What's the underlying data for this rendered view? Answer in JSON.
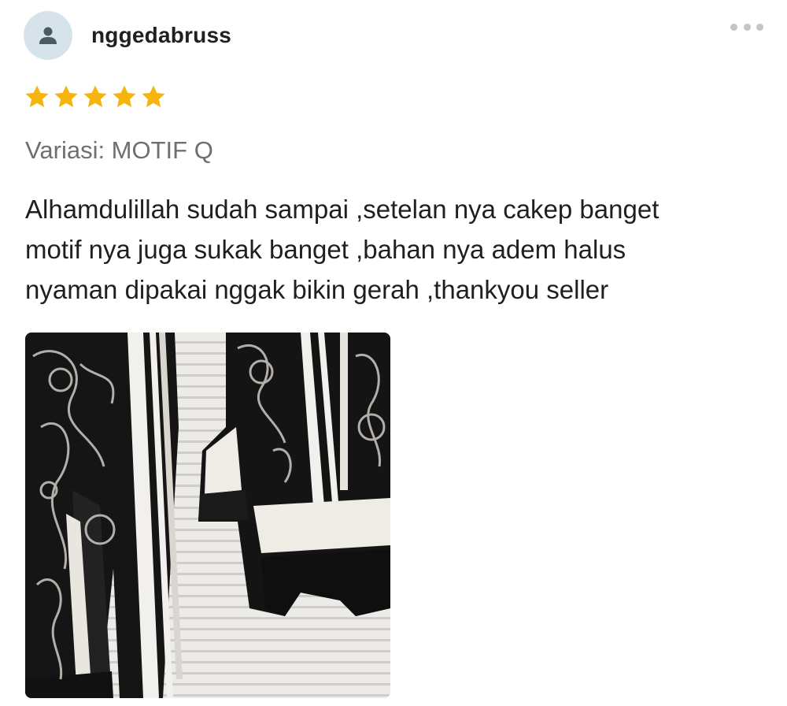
{
  "reviewer": {
    "avatar_icon": "user-icon",
    "name": "nggedabruss"
  },
  "more_icon": "more-horizontal-icon",
  "rating": {
    "stars": 5,
    "max": 5,
    "color": "#F6B40E"
  },
  "variant": "Variasi: MOTIF Q",
  "comment": {
    "lines": [
      "Alhamdulillah sudah sampai ,setelan nya cakep banget",
      "motif nya juga sukak banget ,bahan nya adem halus",
      "nyaman dipakai nggak bikin gerah ,thankyou seller"
    ]
  },
  "photo": {
    "alt": "review-photo"
  }
}
